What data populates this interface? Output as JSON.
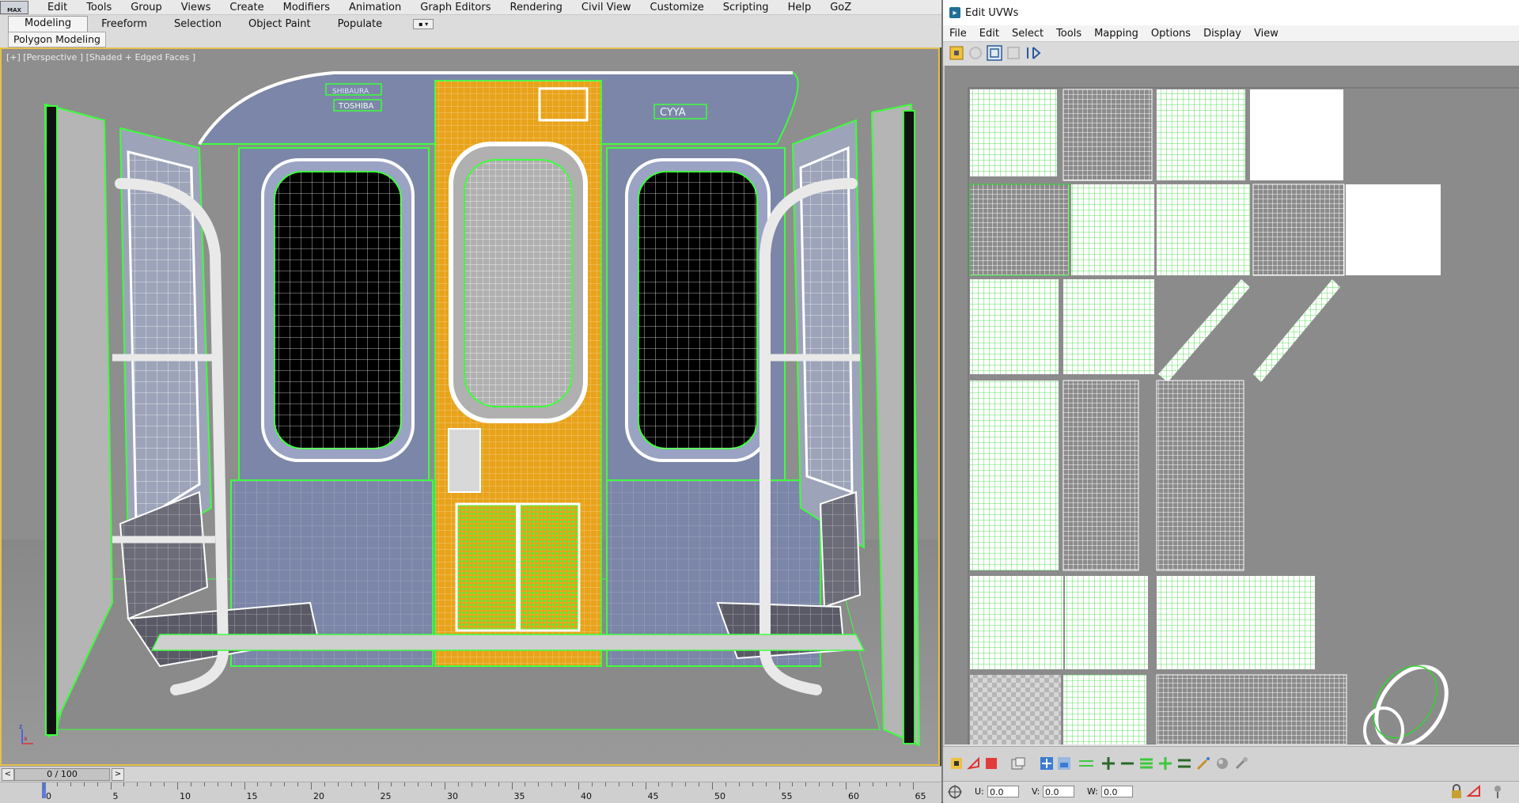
{
  "app": {
    "logo": "MAX",
    "menu": [
      "Edit",
      "Tools",
      "Group",
      "Views",
      "Create",
      "Modifiers",
      "Animation",
      "Graph Editors",
      "Rendering",
      "Civil View",
      "Customize",
      "Scripting",
      "Help",
      "GoZ"
    ]
  },
  "ribbon": {
    "tabs": [
      "Modeling",
      "Freeform",
      "Selection",
      "Object Paint",
      "Populate"
    ],
    "active_tab": "Modeling",
    "panel_label": "Polygon Modeling"
  },
  "viewport": {
    "label": "[+] [Perspective ] [Shaded + Edged Faces ]",
    "axis_x": "x",
    "axis_z": "z",
    "sign_left_1": "SHIBAURA",
    "sign_left_2": "TOSHIBA",
    "sign_right": "CYYA"
  },
  "timeline": {
    "frame_display": "0 / 100",
    "prev_label": "<",
    "next_label": ">",
    "ticks": [
      "0",
      "5",
      "10",
      "15",
      "20",
      "25",
      "30",
      "35",
      "40",
      "45",
      "50",
      "55",
      "60",
      "65"
    ]
  },
  "uv_editor": {
    "title": "Edit UVWs",
    "menu": [
      "File",
      "Edit",
      "Select",
      "Tools",
      "Mapping",
      "Options",
      "Display",
      "View"
    ],
    "toolbar_icons": [
      "move-icon",
      "rotate-icon",
      "scale-icon",
      "freeform-icon",
      "mirror-icon"
    ],
    "bottom_icons": [
      "paint-select-icon",
      "lasso-icon",
      "rect-select-icon",
      "checker-icon",
      "align-icon",
      "stack-icon",
      "weld-icon",
      "add-icon",
      "subtract-icon",
      "stitch-icon",
      "break-icon",
      "brush-icon",
      "relax-icon",
      "pin-icon"
    ],
    "status": {
      "u_label": "U:",
      "u_value": "0.0",
      "v_label": "V:",
      "v_value": "0.0",
      "w_label": "W:",
      "w_value": "0.0"
    }
  },
  "colors": {
    "wire": "#3cff3c",
    "door": "#e8a31a",
    "panel": "#7c86a8",
    "active_border": "#e6c04a"
  }
}
